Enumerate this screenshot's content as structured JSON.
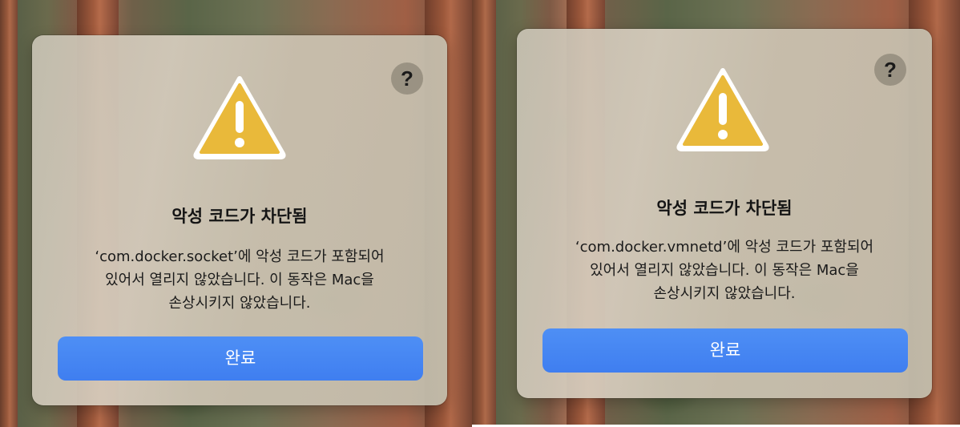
{
  "dialogs": [
    {
      "help_label": "?",
      "icon": "warning-triangle-icon",
      "title": "악성 코드가 차단됨",
      "message_lines": [
        "‘com.docker.socket’에 악성 코드가 포함되어",
        "있어서 열리지 않았습니다. 이 동작은 Mac을",
        "손상시키지 않았습니다."
      ],
      "button_label": "완료"
    },
    {
      "help_label": "?",
      "icon": "warning-triangle-icon",
      "title": "악성 코드가 차단됨",
      "message_lines": [
        "‘com.docker.vmnetd’에 악성 코드가 포함되어",
        "있어서 열리지 않았습니다. 이 동작은 Mac을",
        "손상시키지 않았습니다."
      ],
      "button_label": "완료"
    }
  ],
  "colors": {
    "button": "#3f7ef0",
    "warning_fill": "#e9b93a",
    "warning_border": "#ffffff"
  }
}
